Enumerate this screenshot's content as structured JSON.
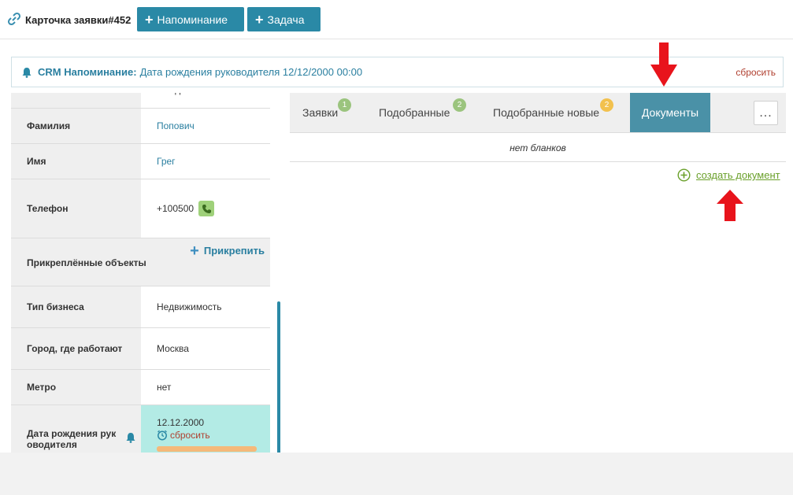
{
  "header": {
    "title": "Карточка заявки#452",
    "reminder_button": "Напоминание",
    "task_button": "Задача"
  },
  "reminder": {
    "label": "CRM Напоминание:",
    "text": "Дата рождения руководителя 12/12/2000 00:00",
    "reset": "сбросить"
  },
  "fields": {
    "activity": {
      "label": "Активность",
      "value": "сегодня 10:47"
    },
    "lastname": {
      "label": "Фамилия",
      "value": "Попович"
    },
    "firstname": {
      "label": "Имя",
      "value": "Грег"
    },
    "phone": {
      "label": "Телефон",
      "value": "+100500"
    },
    "attached": {
      "label": "Прикреплённые объекты",
      "attach": "Прикрепить"
    },
    "business": {
      "label": "Тип бизнеса",
      "value": "Недвижимость"
    },
    "city": {
      "label": "Город, где работают",
      "value": "Москва"
    },
    "metro": {
      "label": "Метро",
      "value": "нет"
    },
    "birthday": {
      "label": "Дата рождения рук оводителя",
      "value": "12.12.2000",
      "reset": "сбросить"
    }
  },
  "tabs": [
    {
      "label": "Заявки",
      "badge": "1",
      "badge_color": "#9bc47e"
    },
    {
      "label": "Подобранные",
      "badge": "2",
      "badge_color": "#9bc47e"
    },
    {
      "label": "Подобранные новые",
      "badge": "2",
      "badge_color": "#f2c14e"
    },
    {
      "label": "Документы",
      "active": true
    }
  ],
  "more_button": "...",
  "documents": {
    "empty_text": "нет бланков",
    "create_link": "создать документ"
  },
  "colors": {
    "accent": "#2a89a6",
    "active_tab": "#4a91a7",
    "reset_red": "#b04030",
    "create_green": "#6aa02a",
    "arrow_red": "#e8141c"
  }
}
